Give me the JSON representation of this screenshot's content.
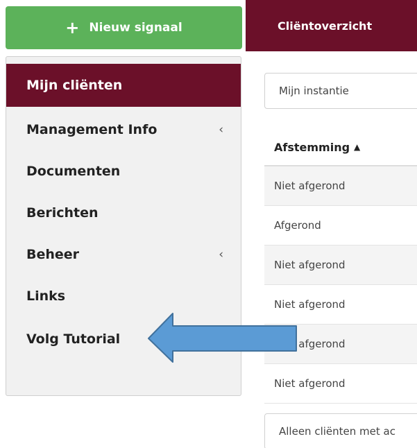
{
  "new_signal": {
    "icon": "plus-icon",
    "label": "Nieuw signaal"
  },
  "sidebar": {
    "items": [
      {
        "label": "Mijn cliënten",
        "active": true
      },
      {
        "label": "Management Info",
        "chevron": "‹"
      },
      {
        "label": "Documenten"
      },
      {
        "label": "Berichten"
      },
      {
        "label": "Beheer",
        "chevron": "‹"
      },
      {
        "label": "Links"
      },
      {
        "label": "Volg Tutorial"
      }
    ]
  },
  "top_tab": {
    "label": "Cliëntoverzicht"
  },
  "instance_select": {
    "value": "Mijn instantie"
  },
  "table": {
    "header": "Afstemming",
    "sort_icon": "sort-icon",
    "rows": [
      "Niet afgerond",
      "Afgerond",
      "Niet afgerond",
      "Niet afgerond",
      "Niet afgerond",
      "Niet afgerond"
    ]
  },
  "filter": {
    "label": "Alleen cliënten met ac"
  },
  "colors": {
    "accent": "#6b1029",
    "success": "#5cb25a",
    "arrow_fill": "#5b9bd5",
    "arrow_stroke": "#41719c"
  }
}
